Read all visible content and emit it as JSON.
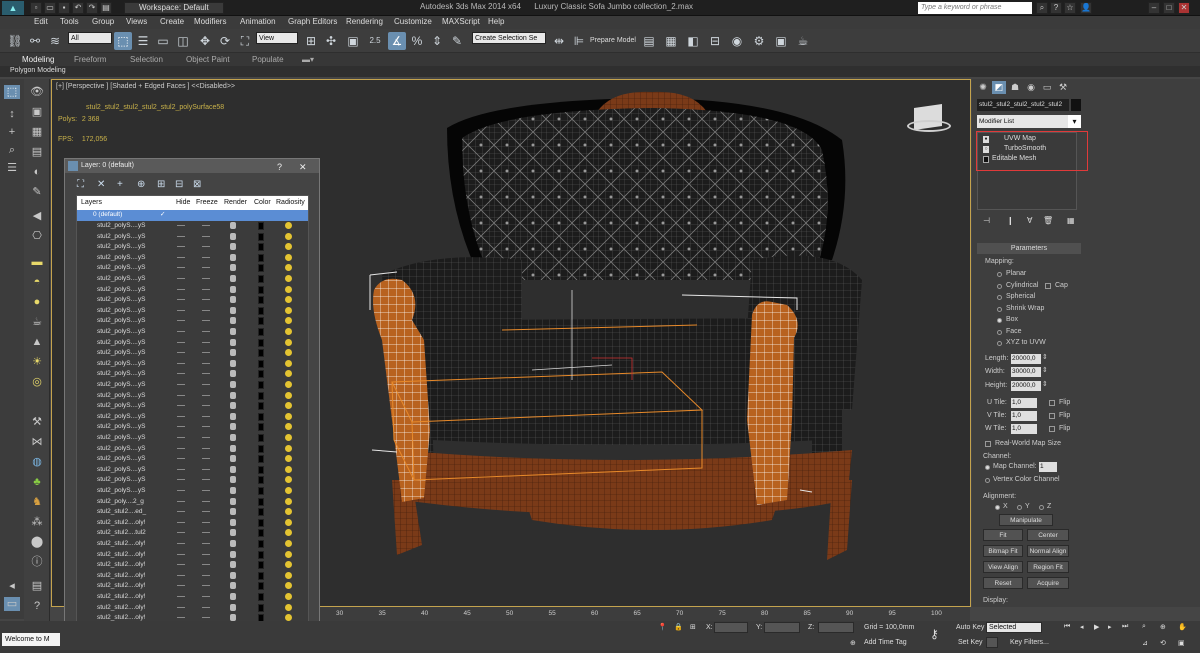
{
  "titlebar": {
    "workspace": "Workspace: Default",
    "app": "Autodesk 3ds Max  2014 x64",
    "file": "Luxury Classic Sofa Jumbo collection_2.max",
    "search_placeholder": "Type a keyword or phrase"
  },
  "menu": [
    "Edit",
    "Tools",
    "Group",
    "Views",
    "Create",
    "Modifiers",
    "Animation",
    "Graph Editors",
    "Rendering",
    "Customize",
    "MAXScript",
    "Help"
  ],
  "toolbar": {
    "filter": "All",
    "refcoord": "View",
    "selset": "Create Selection Se",
    "prepare_model": "Prepare Model",
    "snaps_label": "2.5"
  },
  "ribbon": {
    "tabs": [
      "Modeling",
      "Freeform",
      "Selection",
      "Object Paint",
      "Populate"
    ],
    "sub": "Polygon Modeling"
  },
  "viewport": {
    "label": "[+] [Perspective ] [Shaded + Edged Faces ]  <<Disabled>>",
    "object_name": "stul2_stul2_stul2_stul2_stul2_polySurface58",
    "polys_label": "Polys:",
    "polys_value": "2 368",
    "fps_label": "FPS:",
    "fps_value": "172,056"
  },
  "layer_dialog": {
    "title": "Layer: 0 (default)",
    "question": "?",
    "close": "✕",
    "tools": [
      "⛶",
      "✕",
      "+",
      "⊕",
      "⊞",
      "⊟",
      "⊠"
    ],
    "columns": [
      "Layers",
      "Hide",
      "Freeze",
      "Render",
      "Color",
      "Radiosity"
    ],
    "selected_layer": "0 (default)",
    "layers": [
      "stul2_polyS....yS",
      "stul2_polyS....yS",
      "stul2_polyS....yS",
      "stul2_polyS....yS",
      "stul2_polyS....yS",
      "stul2_polyS....yS",
      "stul2_polyS....yS",
      "stul2_polyS....yS",
      "stul2_polyS....yS",
      "stul2_polyS....yS",
      "stul2_polyS....yS",
      "stul2_polyS....yS",
      "stul2_polyS....yS",
      "stul2_polyS....yS",
      "stul2_polyS....yS",
      "stul2_polyS....yS",
      "stul2_polyS....yS",
      "stul2_polyS....yS",
      "stul2_polyS....yS",
      "stul2_polyS....yS",
      "stul2_polyS....yS",
      "stul2_polyS....yS",
      "stul2_polyS....yS",
      "stul2_polyS....yS",
      "stul2_polyS....yS",
      "stul2_polyS....yS",
      "stul2_poly....2_g",
      "stul2_stul2....ed_",
      "stul2_stul2....oly!",
      "stul2_stul2....tul2",
      "stul2_stul2....oly!",
      "stul2_stul2....oly!",
      "stul2_stul2....oly!",
      "stul2_stul2....oly!",
      "stul2_stul2....oly!",
      "stul2_stul2....oly!",
      "stul2_stul2....oly!",
      "stul2_stul2....oly!",
      "stul2_stul2....oly!",
      "stul2_stul2....oly!"
    ]
  },
  "command_panel": {
    "object_name": "stul2_stul2_stul2_stul2_stul2",
    "modifier_list": "Modifier List",
    "stack": [
      "UVW Map",
      "TurboSmooth",
      "Editable Mesh"
    ],
    "parameters": "Parameters",
    "mapping_label": "Mapping:",
    "mapping": [
      "Planar",
      "Cylindrical",
      "Spherical",
      "Shrink Wrap",
      "Box",
      "Face",
      "XYZ to UVW"
    ],
    "mapping_selected": "Box",
    "cap": "Cap",
    "length_label": "Length:",
    "length": "20000,0",
    "width_label": "Width:",
    "width": "30000,0",
    "height_label": "Height:",
    "height": "20000,0",
    "utile_label": "U Tile:",
    "utile": "1,0",
    "vtile_label": "V Tile:",
    "vtile": "1,0",
    "wtile_label": "W Tile:",
    "wtile": "1,0",
    "flip": "Flip",
    "realworld": "Real-World Map Size",
    "channel_label": "Channel:",
    "map_channel": "Map Channel:",
    "map_channel_value": "1",
    "vertex_color": "Vertex Color Channel",
    "alignment_label": "Alignment:",
    "axis": [
      "X",
      "Y",
      "Z"
    ],
    "buttons": [
      "Manipulate",
      "Fit",
      "Center",
      "Bitmap Fit",
      "Normal Align",
      "View Align",
      "Region Fit",
      "Reset",
      "Acquire"
    ],
    "display_label": "Display:"
  },
  "timeline": {
    "ticks": [
      "30",
      "35",
      "40",
      "45",
      "50",
      "55",
      "60",
      "65",
      "70",
      "75",
      "80",
      "85",
      "90",
      "95",
      "100"
    ]
  },
  "status": {
    "welcome": "Welcome to M",
    "x": "X:",
    "y": "Y:",
    "z": "Z:",
    "grid": "Grid = 100,0mm",
    "add_time_tag": "Add Time Tag",
    "auto_key": "Auto Key",
    "selected": "Selected",
    "set_key": "Set Key",
    "key_filters": "Key Filters..."
  }
}
